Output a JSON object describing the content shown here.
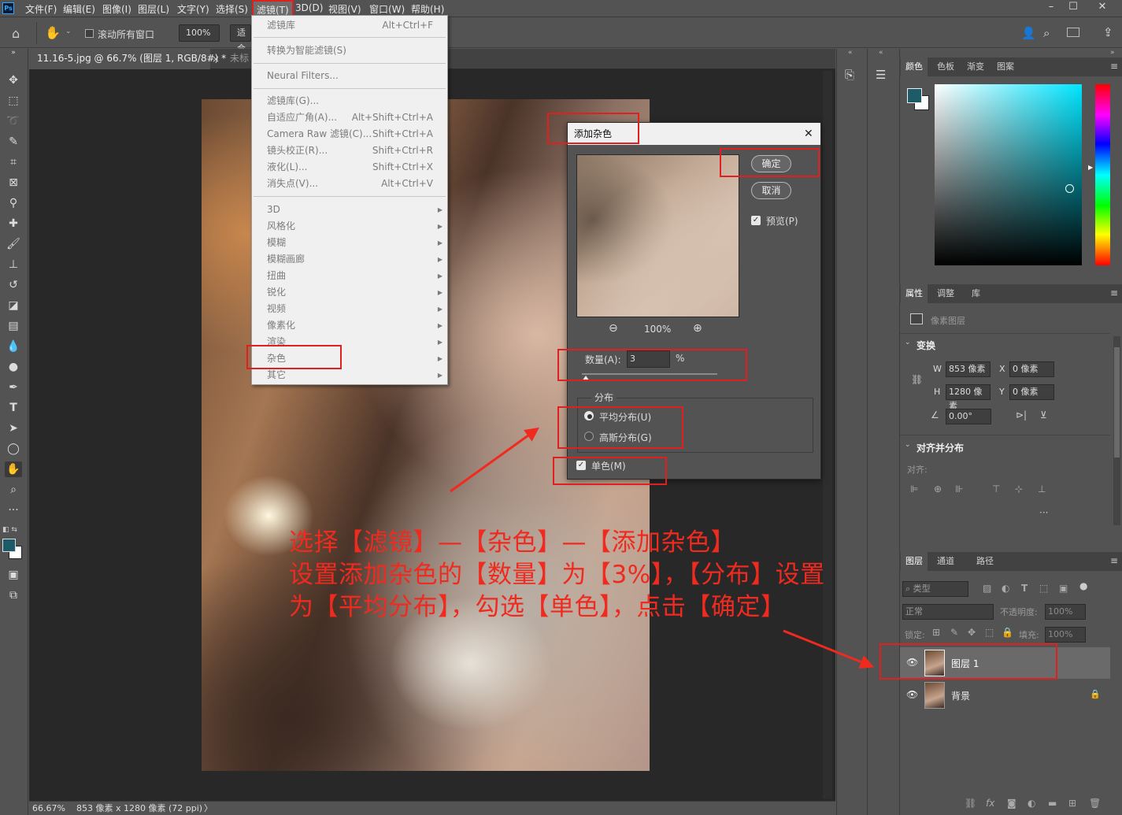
{
  "menubar": {
    "app_icon": "Ps",
    "items": [
      "文件(F)",
      "编辑(E)",
      "图像(I)",
      "图层(L)",
      "文字(Y)",
      "选择(S)",
      "滤镜(T)",
      "3D(D)",
      "视图(V)",
      "窗口(W)",
      "帮助(H)"
    ],
    "active_item": "滤镜(T)"
  },
  "options_bar": {
    "scroll_all_label": "滚动所有窗口",
    "zoom_value": "100%",
    "fit_label": "适合"
  },
  "tabs": {
    "doc1": "11.16-5.jpg @ 66.7% (图层 1, RGB/8#) *",
    "doc2": "未标"
  },
  "statusbar": {
    "zoom": "66.67%",
    "doc_info": "853 像素 x 1280 像素 (72 ppi)",
    "arrow": "〉"
  },
  "filter_menu": {
    "items": [
      {
        "label": "滤镜库",
        "shortcut": "Alt+Ctrl+F"
      },
      {
        "label": "转换为智能滤镜(S)",
        "shortcut": ""
      },
      {
        "label": "Neural Filters...",
        "shortcut": ""
      },
      {
        "label": "滤镜库(G)...",
        "shortcut": ""
      },
      {
        "label": "自适应广角(A)...",
        "shortcut": "Alt+Shift+Ctrl+A"
      },
      {
        "label": "Camera Raw 滤镜(C)...",
        "shortcut": "Shift+Ctrl+A"
      },
      {
        "label": "镜头校正(R)...",
        "shortcut": "Shift+Ctrl+R"
      },
      {
        "label": "液化(L)...",
        "shortcut": "Shift+Ctrl+X"
      },
      {
        "label": "消失点(V)...",
        "shortcut": "Alt+Ctrl+V"
      }
    ],
    "submenus": [
      "3D",
      "风格化",
      "模糊",
      "模糊画廊",
      "扭曲",
      "锐化",
      "视频",
      "像素化",
      "渲染",
      "杂色",
      "其它"
    ]
  },
  "dialog": {
    "title": "添加杂色",
    "ok_label": "确定",
    "cancel_label": "取消",
    "preview_label": "预览(P)",
    "zoom_label": "100%",
    "amount_label": "数量(A):",
    "amount_value": "3",
    "amount_unit": "%",
    "amount_fraction": 0.03,
    "distribution_label": "分布",
    "uniform_label": "平均分布(U)",
    "gaussian_label": "高斯分布(G)",
    "monochrome_label": "单色(M)",
    "preview_checked": true,
    "uniform_selected": true,
    "monochrome_checked": true
  },
  "color_panel": {
    "tabs": [
      "颜色",
      "色板",
      "渐变",
      "图案"
    ],
    "foreground_color": "#1d5b69",
    "background_color": "#ffffff"
  },
  "properties_panel": {
    "tabs": [
      "属性",
      "调整",
      "库"
    ],
    "type_label": "像素图层",
    "transform_label": "变换",
    "w_label": "W",
    "w_value": "853 像素",
    "h_label": "H",
    "h_value": "1280 像素",
    "x_label": "X",
    "x_value": "0 像素",
    "y_label": "Y",
    "y_value": "0 像素",
    "angle_value": "0.00°",
    "align_label": "对齐并分布",
    "align_sub": "对齐:",
    "more": "···"
  },
  "layers_panel": {
    "tabs": [
      "图层",
      "通道",
      "路径"
    ],
    "filter_label": "类型",
    "blend_mode": "正常",
    "opacity_label": "不透明度:",
    "opacity_value": "100%",
    "lock_label": "锁定:",
    "fill_label": "填充:",
    "fill_value": "100%",
    "layers": [
      {
        "name": "图层 1"
      },
      {
        "name": "背景"
      }
    ],
    "footer_fx": "fx"
  },
  "annotation": {
    "line1": "选择【滤镜】—【杂色】—【添加杂色】",
    "line2": "设置添加杂色的【数量】为【3%】，【分布】设置",
    "line3": "为【平均分布】，勾选【单色】，点击【确定】"
  },
  "colors": {
    "annotation_red": "#f02a1f",
    "ui_gray": "#535353",
    "doc_bg": "#282828"
  }
}
